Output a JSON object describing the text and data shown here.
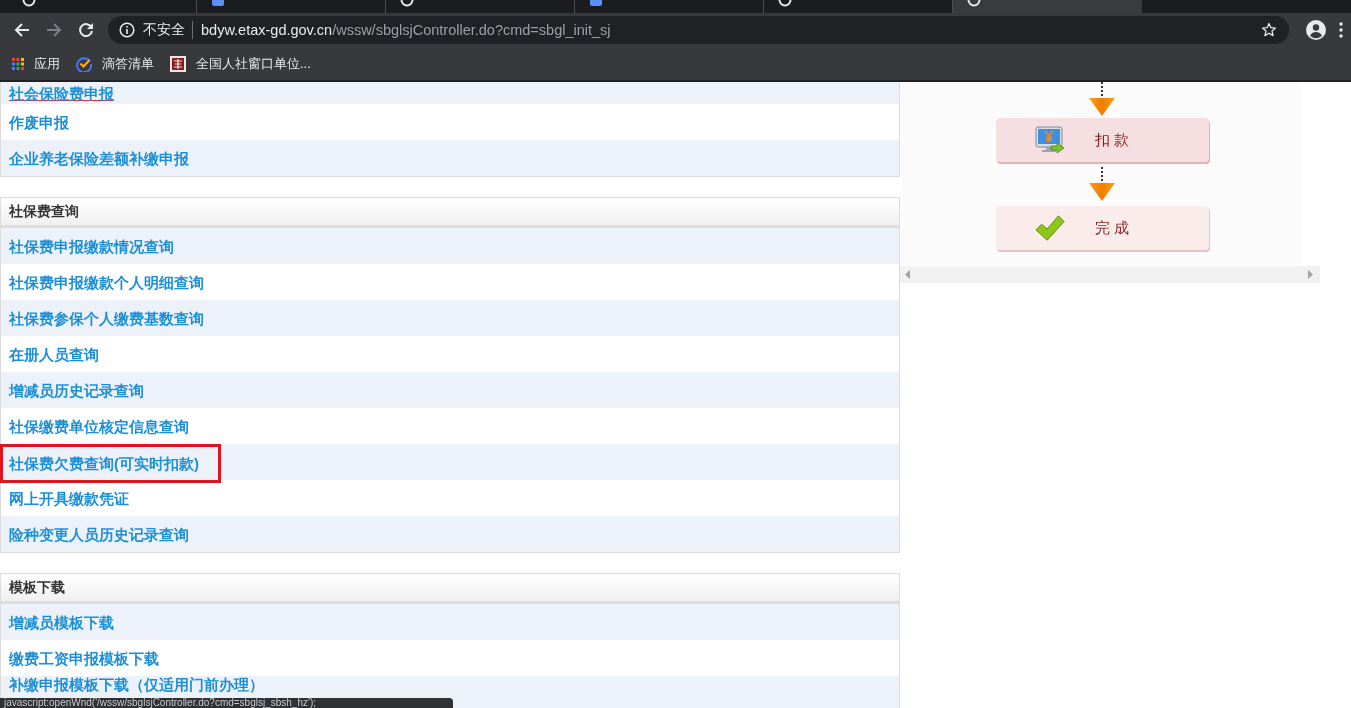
{
  "browser": {
    "tabs": [
      {
        "kind": "round",
        "selected": false
      },
      {
        "kind": "square",
        "selected": false
      },
      {
        "kind": "round",
        "selected": false
      },
      {
        "kind": "square",
        "selected": false
      },
      {
        "kind": "round",
        "selected": false
      },
      {
        "kind": "round",
        "selected": true
      }
    ],
    "nav_buttons": [
      {
        "kind": "back",
        "disabled": false
      },
      {
        "kind": "forward",
        "disabled": true
      },
      {
        "kind": "reload",
        "disabled": false
      }
    ],
    "address_bar": {
      "security_label": "不安全",
      "host": "bdyw.etax-gd.gov.cn",
      "path": "/wssw/sbglsjController.do?cmd=sbgl_init_sj"
    },
    "bookmarks": [
      {
        "kind": "apps",
        "label": "应用"
      },
      {
        "kind": "check",
        "label": "滴答清单"
      },
      {
        "kind": "site",
        "label": "全国人社窗口单位..."
      }
    ]
  },
  "sections": [
    {
      "items": [
        {
          "label": "社会保险费申报",
          "hovered": true,
          "highlighted": false
        },
        {
          "label": "作废申报",
          "hovered": false,
          "highlighted": false
        },
        {
          "label": "企业养老保险差额补缴申报",
          "hovered": false,
          "highlighted": false
        }
      ]
    },
    {
      "title": "社保费查询",
      "items": [
        {
          "label": "社保费申报缴款情况查询",
          "hovered": false,
          "highlighted": false
        },
        {
          "label": "社保费申报缴款个人明细查询",
          "hovered": false,
          "highlighted": false
        },
        {
          "label": "社保费参保个人缴费基数查询",
          "hovered": false,
          "highlighted": false
        },
        {
          "label": "在册人员查询",
          "hovered": false,
          "highlighted": false
        },
        {
          "label": "增减员历史记录查询",
          "hovered": false,
          "highlighted": false
        },
        {
          "label": "社保缴费单位核定信息查询",
          "hovered": false,
          "highlighted": false
        },
        {
          "label": "社保费欠费查询(可实时扣款)",
          "hovered": false,
          "highlighted": true
        },
        {
          "label": "网上开具缴款凭证",
          "hovered": false,
          "highlighted": false
        },
        {
          "label": "险种变更人员历史记录查询",
          "hovered": false,
          "highlighted": false
        }
      ]
    },
    {
      "title": "模板下载",
      "items": [
        {
          "label": "增减员模板下载",
          "hovered": false,
          "highlighted": false
        },
        {
          "label": "缴费工资申报模板下载",
          "hovered": false,
          "highlighted": false
        },
        {
          "label": "补缴申报模板下载（仅适用门前办理）",
          "hovered": false,
          "highlighted": false
        }
      ]
    }
  ],
  "flow": {
    "steps": [
      {
        "kind": "payment",
        "label": "扣 款"
      },
      {
        "kind": "done",
        "label": "完 成"
      }
    ]
  },
  "status_bubble": {
    "text": "javascript:openWnd('/wssw/sbglsjController.do?cmd=sbglsj_sbsh_hz');"
  }
}
